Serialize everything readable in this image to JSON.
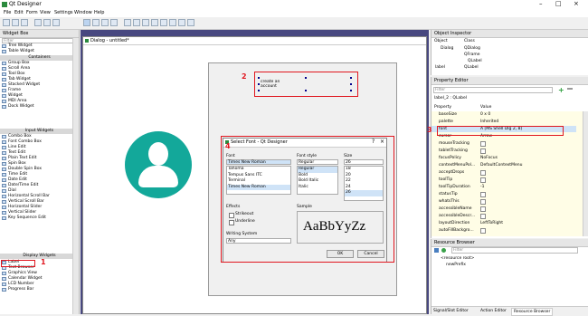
{
  "window": {
    "title": "Qt Designer"
  },
  "menu": [
    "File",
    "Edit",
    "Form",
    "View",
    "Settings",
    "Window",
    "Help"
  ],
  "widget_box": {
    "title": "Widget Box",
    "filter_placeholder": "Filter",
    "top_items": [
      "Tree Widget",
      "Table Widget"
    ],
    "categories": {
      "containers": "Containers",
      "input": "Input Widgets",
      "display": "Display Widgets"
    },
    "containers": [
      "Group Box",
      "Scroll Area",
      "Tool Box",
      "Tab Widget",
      "Stacked Widget",
      "Frame",
      "Widget",
      "MDI Area",
      "Dock Widget"
    ],
    "input": [
      "Combo Box",
      "Font Combo Box",
      "Line Edit",
      "Text Edit",
      "Plain Text Edit",
      "Spin Box",
      "Double Spin Box",
      "Time Edit",
      "Date Edit",
      "Date/Time Edit",
      "Dial",
      "Horizontal Scroll Bar",
      "Vertical Scroll Bar",
      "Horizontal Slider",
      "Vertical Slider",
      "Key Sequence Edit"
    ],
    "display": [
      "Label",
      "Text Browser",
      "Graphics View",
      "Calendar Widget",
      "LCD Number",
      "Progress Bar"
    ]
  },
  "form": {
    "title": "Dialog - untitled*",
    "label_text": "create an account"
  },
  "font_dialog": {
    "title": "Select Font - Qt Designer",
    "font_label": "Font",
    "font_value": "Times New Roman",
    "fonts": [
      "Tahoma",
      "Tempus Sans ITC",
      "Terminal",
      "Times New Roman"
    ],
    "style_label": "Font style",
    "style_value": "Regular",
    "styles": [
      "Regular",
      "Bold",
      "Bold Italic",
      "Italic"
    ],
    "size_label": "Size",
    "size_value": "26",
    "sizes": [
      "18",
      "20",
      "22",
      "24",
      "26"
    ],
    "effects_label": "Effects",
    "strikeout": "Strikeout",
    "underline": "Underline",
    "sample_label": "Sample",
    "sample_text": "AaBbYyZz",
    "writing_system_label": "Writing System",
    "writing_system_value": "Any",
    "ok": "OK",
    "cancel": "Cancel"
  },
  "object_inspector": {
    "title": "Object Inspector",
    "col_object": "Object",
    "col_class": "Class",
    "rows": [
      {
        "object": "Dialog",
        "class": "QDialog"
      },
      {
        "object": "",
        "class": "QFrame"
      },
      {
        "object": "",
        "class": "QLabel"
      },
      {
        "object": "label",
        "class": "QLabel"
      }
    ]
  },
  "property_editor": {
    "title": "Property Editor",
    "filter_placeholder": "Filter",
    "context": "label_2 : QLabel",
    "col_property": "Property",
    "col_value": "Value",
    "rows": [
      {
        "k": "baseSize",
        "v": "0 x 0"
      },
      {
        "k": "palette",
        "v": "Inherited"
      },
      {
        "k": "font",
        "v": "A [MS Shell Dlg 2, 8]"
      },
      {
        "k": "cursor",
        "v": "Arrow"
      },
      {
        "k": "mouseTracking",
        "v": ""
      },
      {
        "k": "tabletTracking",
        "v": ""
      },
      {
        "k": "focusPolicy",
        "v": "NoFocus"
      },
      {
        "k": "contextMenuPol...",
        "v": "DefaultContextMenu"
      },
      {
        "k": "acceptDrops",
        "v": ""
      },
      {
        "k": "toolTip",
        "v": ""
      },
      {
        "k": "toolTipDuration",
        "v": "-1"
      },
      {
        "k": "statusTip",
        "v": ""
      },
      {
        "k": "whatsThis",
        "v": ""
      },
      {
        "k": "accessibleName",
        "v": ""
      },
      {
        "k": "accessibleDescr...",
        "v": ""
      },
      {
        "k": "layoutDirection",
        "v": "LeftToRight"
      },
      {
        "k": "autoFillBackgro...",
        "v": ""
      }
    ]
  },
  "resource_browser": {
    "title": "Resource Browser",
    "filter_placeholder": "Filter",
    "root": "<resource root>",
    "child": "newPrefix",
    "tabs": [
      "Signal/Slot Editor",
      "Action Editor",
      "Resource Browser"
    ]
  },
  "annotations": [
    "1",
    "2",
    "3",
    "4"
  ],
  "colors": {
    "accent_red": "#e0161f",
    "avatar": "#13a89a",
    "mdi_bg": "#484880"
  }
}
